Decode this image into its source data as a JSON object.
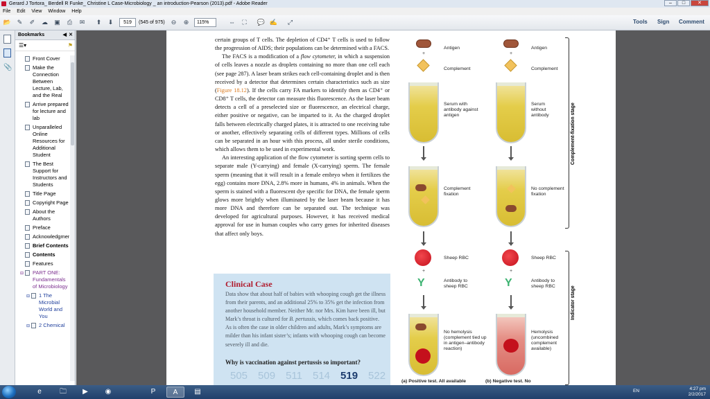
{
  "window": {
    "title": "Gerard J Tortora_ Berdell R Funke_ Christine L Case-Microbiology _ an introduction-Pearson (2013).pdf - Adobe Reader",
    "minimize": "–",
    "maximize": "□",
    "close": "✕"
  },
  "menu": [
    "File",
    "Edit",
    "View",
    "Window",
    "Help"
  ],
  "toolbar": {
    "page_number": "519",
    "page_count": "(545 of 975)",
    "zoom": "115%",
    "tools": "Tools",
    "sign": "Sign",
    "comment": "Comment"
  },
  "bookmarks": {
    "header": "Bookmarks",
    "items": [
      {
        "label": "Front Cover",
        "style": ""
      },
      {
        "label": "Make the Connection Between Lecture, Lab, and the Real",
        "style": ""
      },
      {
        "label": "Arrive prepared for lecture and lab",
        "style": ""
      },
      {
        "label": "Unparalleled Online Resources for Additional Student",
        "style": ""
      },
      {
        "label": "The Best Support for Instructors and Students",
        "style": ""
      },
      {
        "label": "Title Page",
        "style": ""
      },
      {
        "label": "Copyright Page",
        "style": ""
      },
      {
        "label": "About the Authors",
        "style": ""
      },
      {
        "label": "Preface",
        "style": ""
      },
      {
        "label": "Acknowledgments",
        "style": ""
      },
      {
        "label": "Brief Contents",
        "style": "bold"
      },
      {
        "label": "Contents",
        "style": "bold"
      },
      {
        "label": "Features",
        "style": ""
      },
      {
        "label": "PART ONE: Fundamentals of Microbiology",
        "style": "purple"
      },
      {
        "label": "1 The Microbial World and You",
        "style": "blue"
      },
      {
        "label": "2 Chemical",
        "style": "blue"
      }
    ]
  },
  "document": {
    "para1": "certain groups of T cells. The depletion of CD4⁺ T cells is used to follow the progression of AIDS; their populations can be determined with a FACS.",
    "para2_a": "The FACS is a modification of a ",
    "para2_em": "flow cytometer,",
    "para2_b": " in which a suspension of cells leaves a nozzle as droplets containing no more than one cell each (see page 287). A laser beam strikes each cell-containing droplet and is then received by a detector that determines certain characteristics such as size (",
    "para2_ref": "Figure 18.12",
    "para2_c": "). If the cells carry FA markers to identify them as CD4⁺ or CD8⁺ T cells, the detector can measure this fluorescence. As the laser beam detects a cell of a preselected size or fluorescence, an electrical charge, either positive or negative, can be imparted to it. As the charged droplet falls between electrically charged plates, it is attracted to one receiving tube or another, effectively separating cells of different types. Millions of cells can be separated in an hour with this process, all under sterile conditions, which allows them to be used in experimental work.",
    "para3": "An interesting application of the flow cytometer is sorting sperm cells to separate male (Y-carrying) and female (X-carrying) sperm. The female sperm (meaning that it will result in a female embryo when it fertilizes the egg) contains more DNA, 2.8% more in humans, 4% in animals. When the sperm is stained with a fluorescent dye specific for DNA, the female sperm glows more brightly when illuminated by the laser beam because it has more DNA and therefore can be separated out. The technique was developed for agricultural purposes. However, it has received medical approval for use in human couples who carry genes for inherited diseases that affect only boys.",
    "clinical": {
      "title": "Clinical Case",
      "text_a": "Data show that about half of babies with whooping cough get the illness from their parents, and an additional 25% to 35% get the infection from another household member. Neither Mr. nor Mrs. Kim have been ill, but Mark’s throat is cultured for ",
      "text_em": "B. pertussis",
      "text_b": ", which comes back positive. As is often the case in older children and adults, Mark’s symptoms are milder than his infant sister’s; infants with whooping cough can become severely ill and die.",
      "question": "Why is vaccination against pertussis so important?",
      "nav": [
        "505",
        "509",
        "511",
        "514",
        "519",
        "522"
      ],
      "nav_current": "519"
    },
    "figure": {
      "antigen": "Antigen",
      "complement": "Complement",
      "serum_with": "Serum with antibody against antigen",
      "serum_without": "Serum without antibody",
      "fixation": "Complement fixation",
      "no_fixation": "No complement fixation",
      "sheep_rbc": "Sheep RBC",
      "antibody": "Antibody to sheep RBC",
      "no_hemolysis": "No hemolysis (complement tied up in antigen–antibody reaction)",
      "hemolysis": "Hemolysis (uncombined complement available)",
      "stage1": "Complement-fixation stage",
      "stage2": "Indicator stage",
      "pos_caption": "(a) Positive test. All available",
      "neg_caption": "(b) Negative test. No",
      "plus": "+"
    }
  },
  "taskbar": {
    "lang": "EN",
    "time": "4:27 pm",
    "date": "2/2/2017"
  }
}
